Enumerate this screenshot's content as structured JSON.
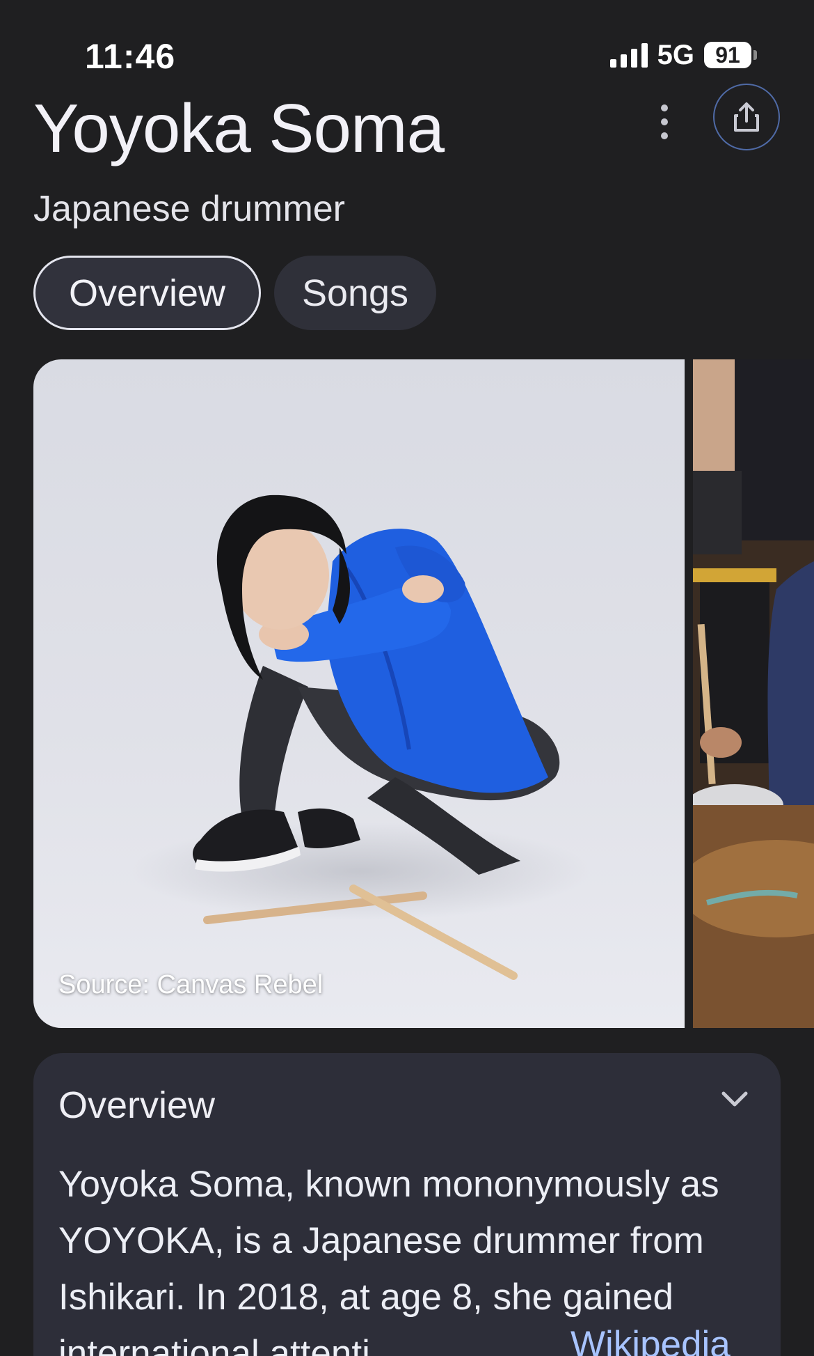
{
  "status_bar": {
    "time": "11:46",
    "network": "5G",
    "battery": "91"
  },
  "header": {
    "title": "Yoyoka Soma",
    "subtitle": "Japanese drummer"
  },
  "tabs": [
    {
      "label": "Overview",
      "selected": true
    },
    {
      "label": "Songs",
      "selected": false
    }
  ],
  "images": {
    "caption": "Source: Canvas Rebel"
  },
  "overview": {
    "title": "Overview",
    "text": "Yoyoka Soma, known mononymously as YOYOKA, is a Japanese drummer from Ishikari. In 2018, at age 8, she gained international attenti",
    "source_link": "Wikipedia"
  },
  "icons": {
    "more": "more-vertical-icon",
    "share": "share-icon",
    "expand": "chevron-down-icon"
  },
  "colors": {
    "background": "#1f1f21",
    "card": "#2d2e39",
    "link": "#a8c4ff",
    "shirt_blue": "#1f5fe0"
  }
}
